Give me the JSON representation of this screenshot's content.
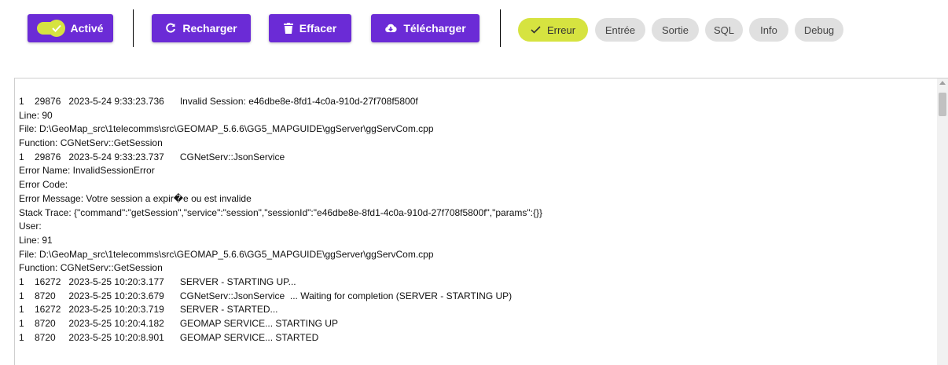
{
  "toolbar": {
    "toggle_label": "Activé",
    "reload_label": "Recharger",
    "clear_label": "Effacer",
    "download_label": "Télécharger"
  },
  "filters": [
    {
      "label": "Erreur",
      "active": true
    },
    {
      "label": "Entrée",
      "active": false
    },
    {
      "label": "Sortie",
      "active": false
    },
    {
      "label": "SQL",
      "active": false
    },
    {
      "label": "Info",
      "active": false
    },
    {
      "label": "Debug",
      "active": false
    }
  ],
  "log": {
    "lines": [
      "1    29876   2023-5-24 9:33:23.736      Invalid Session: e46dbe8e-8fd1-4c0a-910d-27f708f5800f",
      "Line: 90",
      "File: D:\\GeoMap_src\\1telecomms\\src\\GEOMAP_5.6.6\\GG5_MAPGUIDE\\ggServer\\ggServCom.cpp",
      "Function: CGNetServ::GetSession",
      "1    29876   2023-5-24 9:33:23.737      CGNetServ::JsonService",
      "Error Name: InvalidSessionError",
      "Error Code:",
      "Error Message: Votre session a expir�e ou est invalide",
      "Stack Trace: {\"command\":\"getSession\",\"service\":\"session\",\"sessionId\":\"e46dbe8e-8fd1-4c0a-910d-27f708f5800f\",\"params\":{}}",
      "User:",
      "Line: 91",
      "File: D:\\GeoMap_src\\1telecomms\\src\\GEOMAP_5.6.6\\GG5_MAPGUIDE\\ggServer\\ggServCom.cpp",
      "Function: CGNetServ::GetSession",
      "1    16272   2023-5-25 10:20:3.177      SERVER - STARTING UP...",
      "1    8720     2023-5-25 10:20:3.679      CGNetServ::JsonService  ... Waiting for completion (SERVER - STARTING UP)",
      "1    16272   2023-5-25 10:20:3.719      SERVER - STARTED...",
      "1    8720     2023-5-25 10:20:4.182      GEOMAP SERVICE... STARTING UP",
      "1    8720     2023-5-25 10:20:8.901      GEOMAP SERVICE... STARTED"
    ]
  },
  "colors": {
    "button_purple": "#6b2bd6",
    "chip_active": "#d6e340",
    "chip_inactive": "#e0e0e0"
  }
}
